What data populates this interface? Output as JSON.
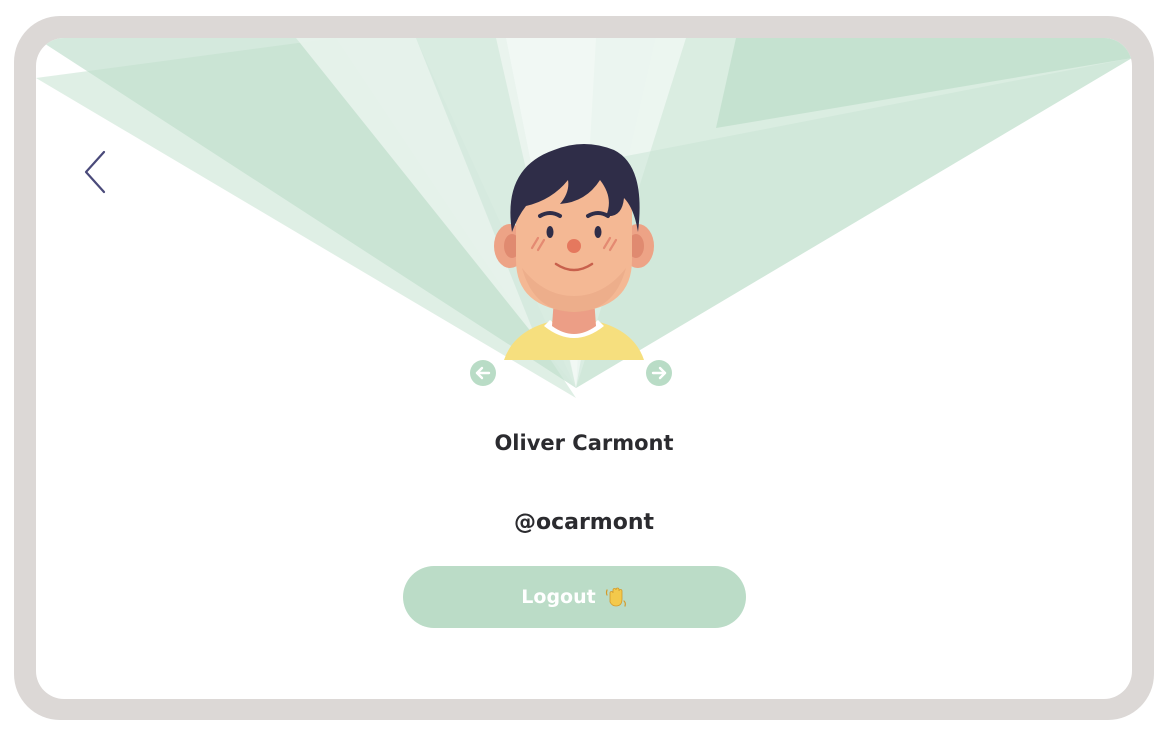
{
  "profile": {
    "display_name": "Oliver Carmont",
    "username": "@ocarmont"
  },
  "actions": {
    "logout_label": "Logout"
  },
  "icons": {
    "back": "chevron-left-icon",
    "prev_avatar": "arrow-left-circle-icon",
    "next_avatar": "arrow-right-circle-icon",
    "logout": "waving-hand-icon"
  },
  "colors": {
    "accent": "#bbdcc7",
    "frame": "#dcd8d6",
    "text": "#2b2b2f",
    "back_chevron": "#4a4a7a"
  }
}
